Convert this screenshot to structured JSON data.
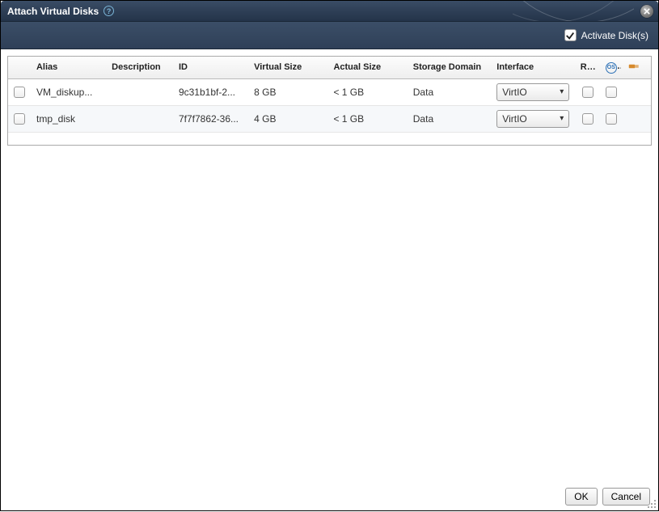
{
  "titlebar": {
    "title": "Attach Virtual Disks",
    "help_symbol": "?"
  },
  "toolbar": {
    "activate_label": "Activate Disk(s)",
    "activate_checked": true
  },
  "table": {
    "headers": {
      "alias": "Alias",
      "description": "Description",
      "id": "ID",
      "virtual_size": "Virtual Size",
      "actual_size": "Actual Size",
      "storage_domain": "Storage Domain",
      "interface": "Interface",
      "ro": "R/O",
      "os": "OS"
    },
    "interface_options": [
      "VirtIO"
    ],
    "rows": [
      {
        "selected": false,
        "alias": "VM_diskup...",
        "description": "",
        "id": "9c31b1bf-2...",
        "virtual_size": "8 GB",
        "actual_size": "< 1 GB",
        "storage_domain": "Data",
        "interface": "VirtIO",
        "ro": false,
        "os": false
      },
      {
        "selected": false,
        "alias": "tmp_disk",
        "description": "",
        "id": "7f7f7862-36...",
        "virtual_size": "4 GB",
        "actual_size": "< 1 GB",
        "storage_domain": "Data",
        "interface": "VirtIO",
        "ro": false,
        "os": false
      }
    ]
  },
  "buttons": {
    "ok": "OK",
    "cancel": "Cancel"
  }
}
